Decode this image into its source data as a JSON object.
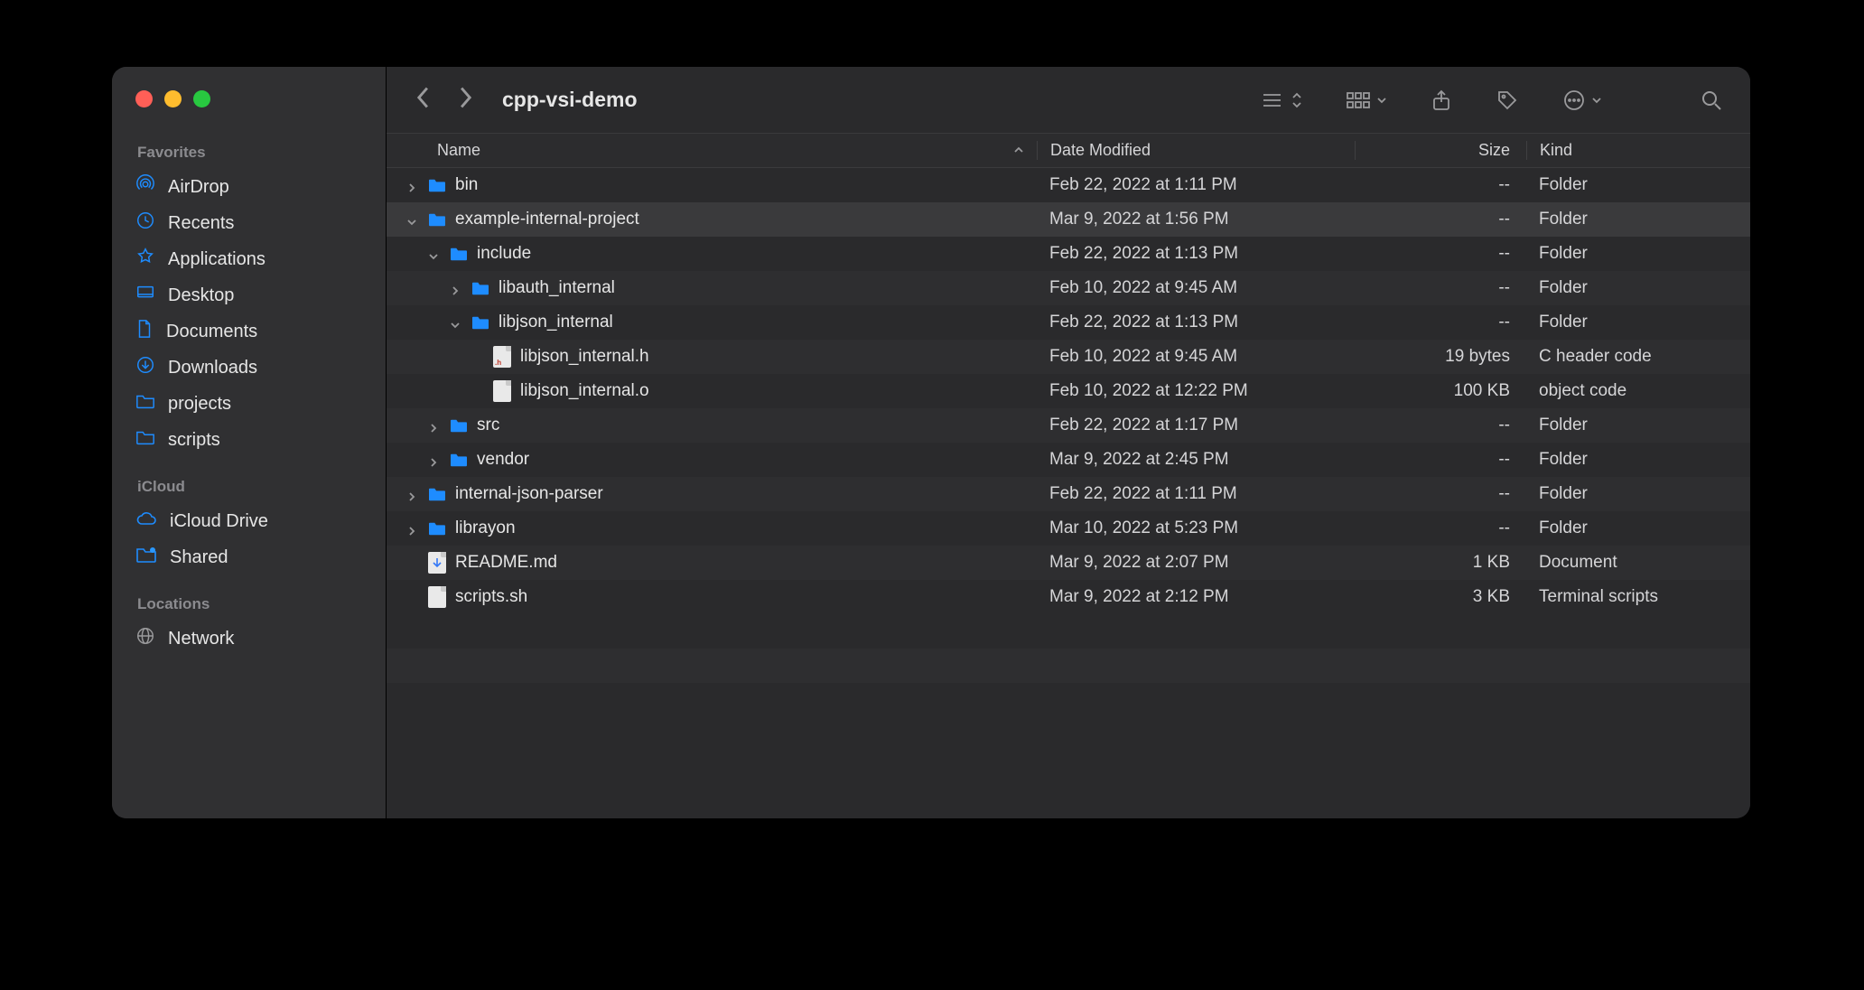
{
  "window": {
    "title": "cpp-vsi-demo"
  },
  "sidebar": {
    "sections": [
      {
        "heading": "Favorites",
        "items": [
          {
            "label": "AirDrop",
            "icon": "airdrop-icon"
          },
          {
            "label": "Recents",
            "icon": "clock-icon"
          },
          {
            "label": "Applications",
            "icon": "applications-icon"
          },
          {
            "label": "Desktop",
            "icon": "desktop-icon"
          },
          {
            "label": "Documents",
            "icon": "document-icon"
          },
          {
            "label": "Downloads",
            "icon": "download-icon"
          },
          {
            "label": "projects",
            "icon": "folder-icon"
          },
          {
            "label": "scripts",
            "icon": "folder-icon"
          }
        ]
      },
      {
        "heading": "iCloud",
        "items": [
          {
            "label": "iCloud Drive",
            "icon": "cloud-icon"
          },
          {
            "label": "Shared",
            "icon": "shared-folder-icon"
          }
        ]
      },
      {
        "heading": "Locations",
        "items": [
          {
            "label": "Network",
            "icon": "globe-icon"
          }
        ]
      }
    ]
  },
  "columns": {
    "name": "Name",
    "date": "Date Modified",
    "size": "Size",
    "kind": "Kind"
  },
  "rows": [
    {
      "indent": 0,
      "disclosure": "closed",
      "icon": "folder",
      "name": "bin",
      "date": "Feb 22, 2022 at 1:11 PM",
      "size": "--",
      "kind": "Folder",
      "selected": false
    },
    {
      "indent": 0,
      "disclosure": "open",
      "icon": "folder",
      "name": "example-internal-project",
      "date": "Mar 9, 2022 at 1:56 PM",
      "size": "--",
      "kind": "Folder",
      "selected": true
    },
    {
      "indent": 1,
      "disclosure": "open",
      "icon": "folder",
      "name": "include",
      "date": "Feb 22, 2022 at 1:13 PM",
      "size": "--",
      "kind": "Folder",
      "selected": false
    },
    {
      "indent": 2,
      "disclosure": "closed",
      "icon": "folder",
      "name": "libauth_internal",
      "date": "Feb 10, 2022 at 9:45 AM",
      "size": "--",
      "kind": "Folder",
      "selected": false
    },
    {
      "indent": 2,
      "disclosure": "open",
      "icon": "folder",
      "name": "libjson_internal",
      "date": "Feb 22, 2022 at 1:13 PM",
      "size": "--",
      "kind": "Folder",
      "selected": false
    },
    {
      "indent": 3,
      "disclosure": "none",
      "icon": "h-file",
      "name": "libjson_internal.h",
      "date": "Feb 10, 2022 at 9:45 AM",
      "size": "19 bytes",
      "kind": "C header code",
      "selected": false
    },
    {
      "indent": 3,
      "disclosure": "none",
      "icon": "o-file",
      "name": "libjson_internal.o",
      "date": "Feb 10, 2022 at 12:22 PM",
      "size": "100 KB",
      "kind": "object code",
      "selected": false
    },
    {
      "indent": 1,
      "disclosure": "closed",
      "icon": "folder",
      "name": "src",
      "date": "Feb 22, 2022 at 1:17 PM",
      "size": "--",
      "kind": "Folder",
      "selected": false
    },
    {
      "indent": 1,
      "disclosure": "closed",
      "icon": "folder",
      "name": "vendor",
      "date": "Mar 9, 2022 at 2:45 PM",
      "size": "--",
      "kind": "Folder",
      "selected": false
    },
    {
      "indent": 0,
      "disclosure": "closed",
      "icon": "folder",
      "name": "internal-json-parser",
      "date": "Feb 22, 2022 at 1:11 PM",
      "size": "--",
      "kind": "Folder",
      "selected": false
    },
    {
      "indent": 0,
      "disclosure": "closed",
      "icon": "folder",
      "name": "librayon",
      "date": "Mar 10, 2022 at 5:23 PM",
      "size": "--",
      "kind": "Folder",
      "selected": false
    },
    {
      "indent": 0,
      "disclosure": "none",
      "icon": "md-file",
      "name": "README.md",
      "date": "Mar 9, 2022 at 2:07 PM",
      "size": "1 KB",
      "kind": "Document",
      "selected": false
    },
    {
      "indent": 0,
      "disclosure": "none",
      "icon": "sh-file",
      "name": "scripts.sh",
      "date": "Mar 9, 2022 at 2:12 PM",
      "size": "3 KB",
      "kind": "Terminal scripts",
      "selected": false
    }
  ]
}
